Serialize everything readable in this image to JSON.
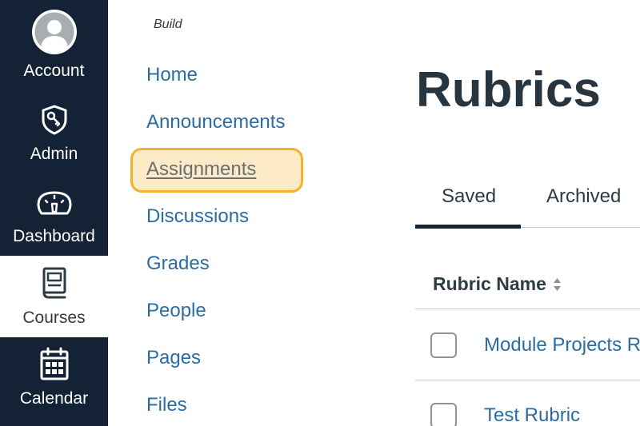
{
  "global_nav": {
    "account": {
      "label": "Account",
      "icon": "avatar-icon"
    },
    "admin": {
      "label": "Admin",
      "icon": "shield-key-icon"
    },
    "dashboard": {
      "label": "Dashboard",
      "icon": "speedometer-icon"
    },
    "courses": {
      "label": "Courses",
      "icon": "book-icon"
    },
    "calendar": {
      "label": "Calendar",
      "icon": "calendar-icon"
    },
    "active": "courses",
    "colors": {
      "background": "#142236",
      "text": "#ffffff"
    }
  },
  "course_nav": {
    "heading": "Build",
    "items": [
      {
        "label": "Home"
      },
      {
        "label": "Announcements"
      },
      {
        "label": "Assignments"
      },
      {
        "label": "Discussions"
      },
      {
        "label": "Grades"
      },
      {
        "label": "People"
      },
      {
        "label": "Pages"
      },
      {
        "label": "Files"
      }
    ],
    "active": "Assignments",
    "colors": {
      "link": "#2b6ca3",
      "focus_ring": "#f6b02b"
    }
  },
  "main": {
    "title": "Rubrics",
    "tabs": [
      {
        "label": "Saved"
      },
      {
        "label": "Archived"
      }
    ],
    "selected_tab": "Saved",
    "table": {
      "column_header": "Rubric Name",
      "rows": [
        {
          "name": "Module Projects R"
        },
        {
          "name": "Test Rubric"
        }
      ]
    }
  }
}
